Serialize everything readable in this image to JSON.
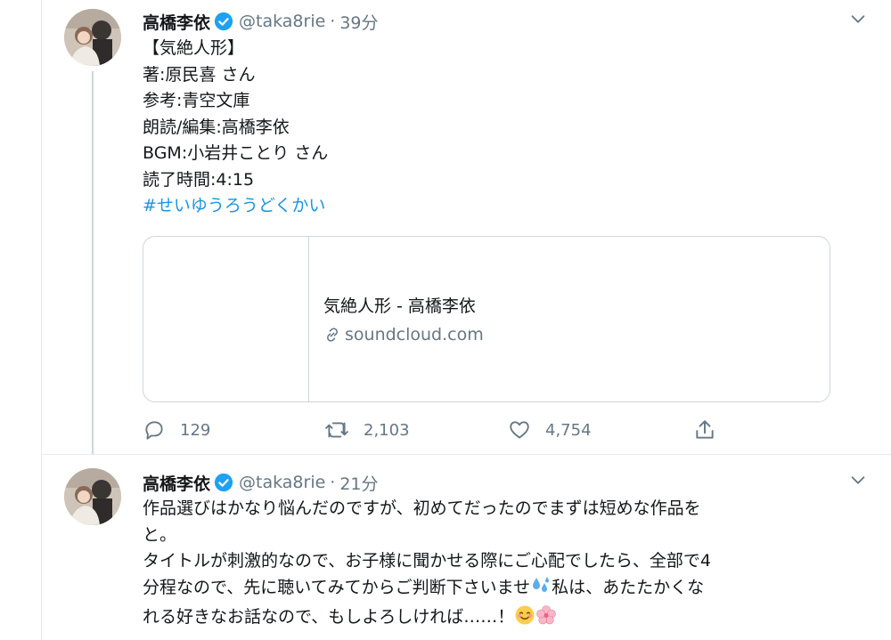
{
  "tweets": [
    {
      "name": "高橋李依",
      "handle": "@taka8rie",
      "dot": "·",
      "time": "39分",
      "lines": [
        "【気絶人形】",
        "著:原民喜 さん",
        "参考:青空文庫",
        "朗読/編集:高橋李依",
        "BGM:小岩井ことり さん",
        "読了時間:4:15"
      ],
      "hashtag": "#せいゆうろうどくかい",
      "card": {
        "title": "気絶人形 - 高橋李依",
        "domain": "soundcloud.com"
      },
      "actions": {
        "replies": "129",
        "retweets": "2,103",
        "likes": "4,754"
      }
    },
    {
      "name": "高橋李依",
      "handle": "@taka8rie",
      "dot": "·",
      "time": "21分",
      "lines": [
        "作品選びはかなり悩んだのですが、初めてだったのでまずは短めな作品を",
        "と。",
        "タイトルが刺激的なので、お子様に聞かせる際にご心配でしたら、全部で4",
        "分程なので、先に聴いてみてからご判断下さいませ",
        "私は、あたたかくな",
        "れる好きなお話なので、もしよろしければ……！"
      ]
    }
  ],
  "icons": {
    "verified": "verified-badge-icon",
    "caret": "chevron-down-icon",
    "reply": "reply-icon",
    "retweet": "retweet-icon",
    "like": "heart-icon",
    "share": "share-icon",
    "link": "link-icon",
    "emoji_sweat": "sweat-droplets-emoji",
    "emoji_smile": "smiling-face-emoji",
    "emoji_blossom": "cherry-blossom-emoji"
  },
  "colors": {
    "accent": "#1b95e0",
    "secondary_text": "#657786",
    "border": "#ccd6dd",
    "verified": "#1da1f2"
  }
}
